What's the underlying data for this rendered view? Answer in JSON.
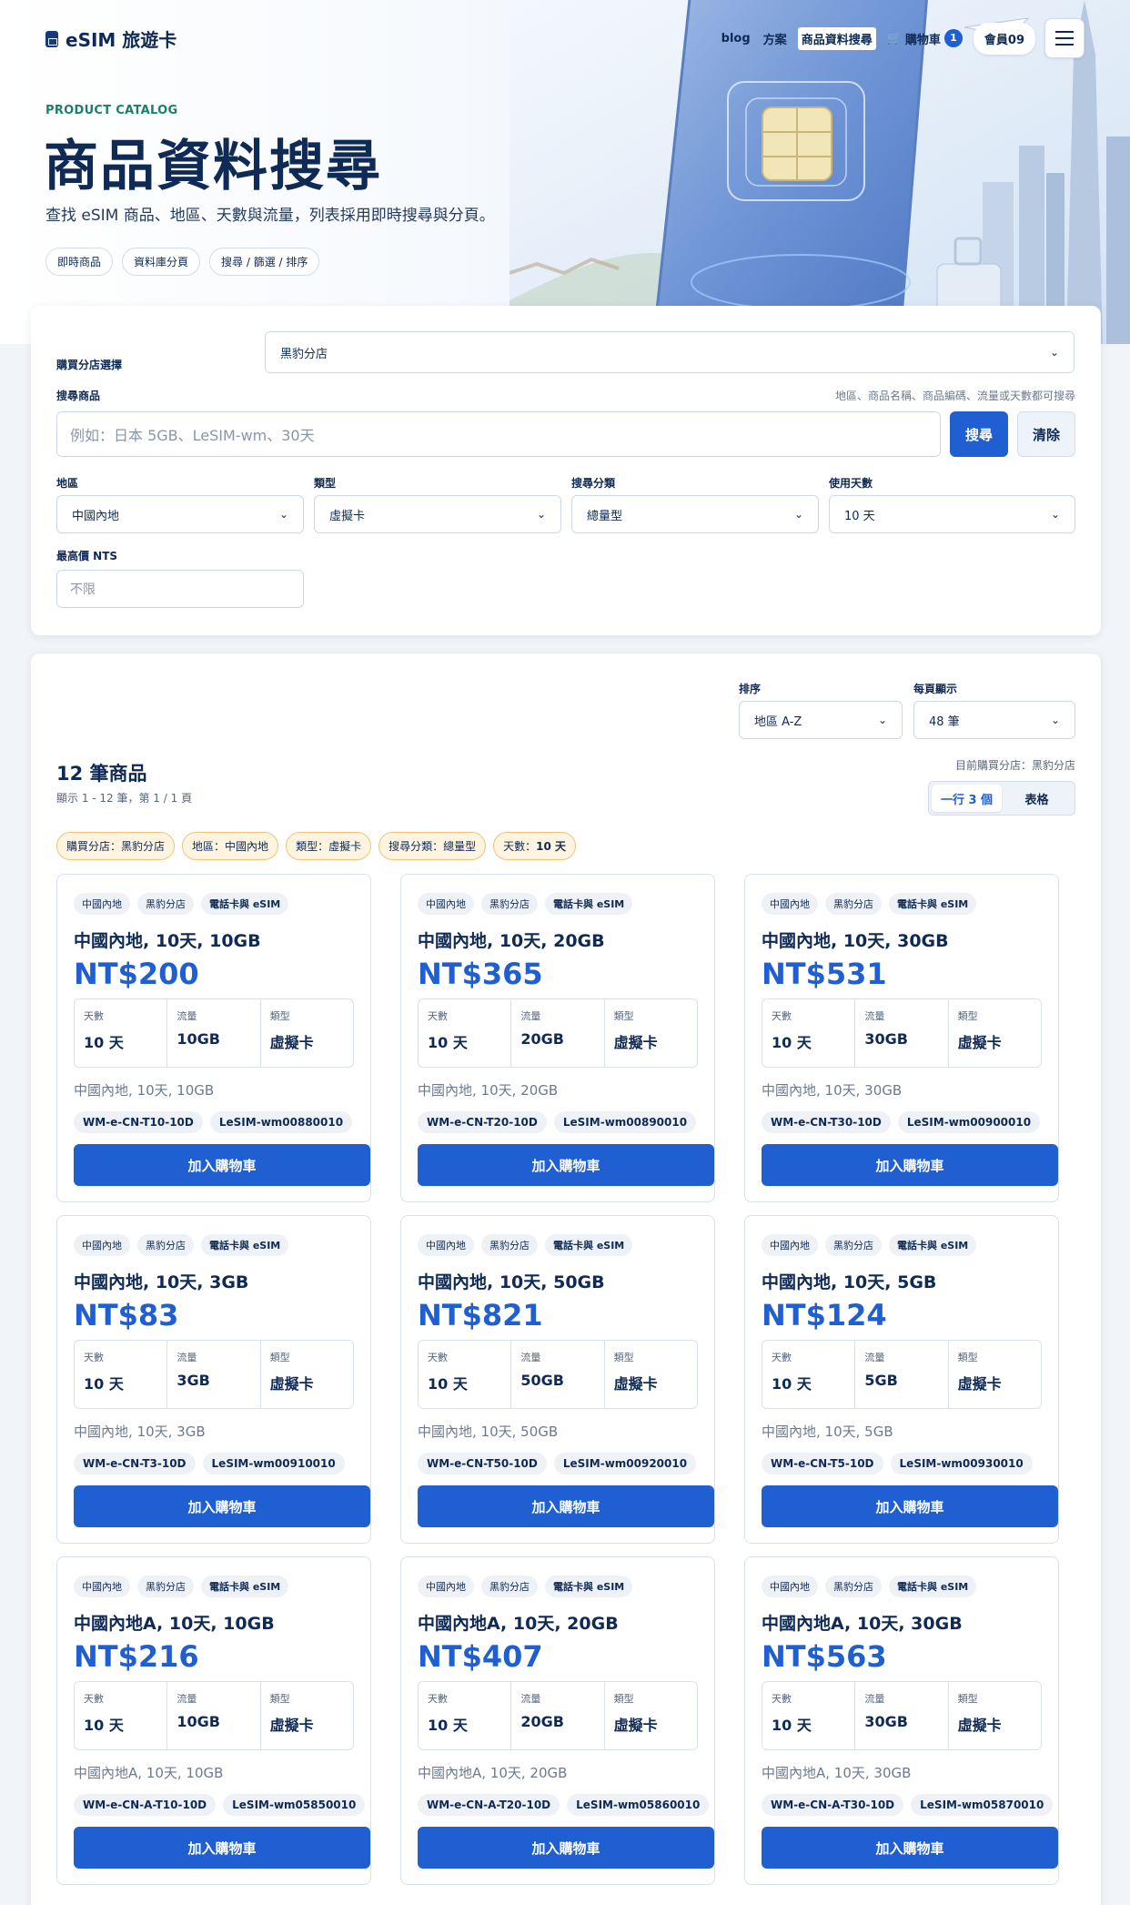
{
  "header": {
    "logo": "eSIM 旅遊卡",
    "nav": [
      "blog",
      "方案",
      "商品資料搜尋"
    ],
    "cart_label": "購物車",
    "cart_count": "1",
    "member_label": "會員09"
  },
  "hero": {
    "eyebrow": "PRODUCT CATALOG",
    "title": "商品資料搜尋",
    "description": "查找 eSIM 商品、地區、天數與流量，列表採用即時搜尋與分頁。",
    "chips": [
      "即時商品",
      "資料庫分頁",
      "搜尋 / 篩選 / 排序"
    ]
  },
  "filters": {
    "store_label": "購買分店選擇",
    "store_value": "黑豹分店",
    "search_label": "搜尋商品",
    "search_hint": "地區、商品名稱、商品編碼、流量或天數都可搜尋",
    "search_placeholder": "例如：日本 5GB、LeSIM-wm、30天",
    "search_button": "搜尋",
    "clear_button": "清除",
    "region_label": "地區",
    "region_value": "中國內地",
    "type_label": "類型",
    "type_value": "虛擬卡",
    "category_label": "搜尋分類",
    "category_value": "總量型",
    "days_label": "使用天數",
    "days_value": "10 天",
    "maxprice_label": "最高價 NTS",
    "maxprice_placeholder": "不限"
  },
  "results": {
    "sort_label": "排序",
    "sort_value": "地區 A-Z",
    "perpage_label": "每頁顯示",
    "perpage_value": "48 筆",
    "count": "12 筆商品",
    "sub": "顯示 1 - 12 筆，第 1 / 1 頁",
    "store_note": "目前購買分店：黑豹分店",
    "view_grid": "一行 3 個",
    "view_table": "表格",
    "filter_tags": [
      {
        "k": "購買分店：",
        "v": "黑豹分店"
      },
      {
        "k": "地區：",
        "v": "中國內地"
      },
      {
        "k": "類型：",
        "v": "虛擬卡"
      },
      {
        "k": "搜尋分類：",
        "v": "總量型"
      },
      {
        "k": "天數：",
        "v": "10 天"
      }
    ]
  },
  "card_labels": {
    "days": "天數",
    "data": "流量",
    "type": "類型",
    "add_to_cart": "加入購物車",
    "tag_store": "黑豹分店",
    "tag_channel": "電話卡與 eSIM"
  },
  "products": [
    {
      "region": "中國內地",
      "title": "中國內地, 10天, 10GB",
      "price": "NT$200",
      "days": "10 天",
      "data": "10GB",
      "type": "虛擬卡",
      "desc": "中國內地, 10天, 10GB",
      "code1": "WM-e-CN-T10-10D",
      "code2": "LeSIM-wm00880010"
    },
    {
      "region": "中國內地",
      "title": "中國內地, 10天, 20GB",
      "price": "NT$365",
      "days": "10 天",
      "data": "20GB",
      "type": "虛擬卡",
      "desc": "中國內地, 10天, 20GB",
      "code1": "WM-e-CN-T20-10D",
      "code2": "LeSIM-wm00890010"
    },
    {
      "region": "中國內地",
      "title": "中國內地, 10天, 30GB",
      "price": "NT$531",
      "days": "10 天",
      "data": "30GB",
      "type": "虛擬卡",
      "desc": "中國內地, 10天, 30GB",
      "code1": "WM-e-CN-T30-10D",
      "code2": "LeSIM-wm00900010"
    },
    {
      "region": "中國內地",
      "title": "中國內地, 10天, 3GB",
      "price": "NT$83",
      "days": "10 天",
      "data": "3GB",
      "type": "虛擬卡",
      "desc": "中國內地, 10天, 3GB",
      "code1": "WM-e-CN-T3-10D",
      "code2": "LeSIM-wm00910010"
    },
    {
      "region": "中國內地",
      "title": "中國內地, 10天, 50GB",
      "price": "NT$821",
      "days": "10 天",
      "data": "50GB",
      "type": "虛擬卡",
      "desc": "中國內地, 10天, 50GB",
      "code1": "WM-e-CN-T50-10D",
      "code2": "LeSIM-wm00920010"
    },
    {
      "region": "中國內地",
      "title": "中國內地, 10天, 5GB",
      "price": "NT$124",
      "days": "10 天",
      "data": "5GB",
      "type": "虛擬卡",
      "desc": "中國內地, 10天, 5GB",
      "code1": "WM-e-CN-T5-10D",
      "code2": "LeSIM-wm00930010"
    },
    {
      "region": "中國內地",
      "title": "中國內地A, 10天, 10GB",
      "price": "NT$216",
      "days": "10 天",
      "data": "10GB",
      "type": "虛擬卡",
      "desc": "中國內地A, 10天, 10GB",
      "code1": "WM-e-CN-A-T10-10D",
      "code2": "LeSIM-wm05850010"
    },
    {
      "region": "中國內地",
      "title": "中國內地A, 10天, 20GB",
      "price": "NT$407",
      "days": "10 天",
      "data": "20GB",
      "type": "虛擬卡",
      "desc": "中國內地A, 10天, 20GB",
      "code1": "WM-e-CN-A-T20-10D",
      "code2": "LeSIM-wm05860010"
    },
    {
      "region": "中國內地",
      "title": "中國內地A, 10天, 30GB",
      "price": "NT$563",
      "days": "10 天",
      "data": "30GB",
      "type": "虛擬卡",
      "desc": "中國內地A, 10天, 30GB",
      "code1": "WM-e-CN-A-T30-10D",
      "code2": "LeSIM-wm05870010"
    }
  ],
  "colors": {
    "primary": "#1f5fd1",
    "navy": "#0f2a55",
    "eyebrow": "#1b7f6a"
  }
}
